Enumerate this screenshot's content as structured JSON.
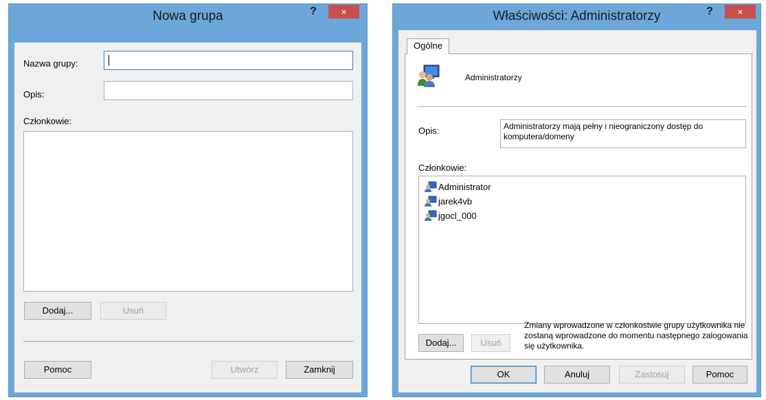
{
  "new_group": {
    "title": "Nowa grupa",
    "help_label": "?",
    "close_label": "×",
    "group_name_label": "Nazwa grupy:",
    "group_name_value": "",
    "description_label": "Opis:",
    "description_value": "",
    "members_label": "Członkowie:",
    "add_button": "Dodaj...",
    "remove_button": "Usuń",
    "help_button": "Pomoc",
    "create_button": "Utwórz",
    "close_button": "Zamknij"
  },
  "properties": {
    "title": "Właściwości: Administratorzy",
    "help_label": "?",
    "close_label": "×",
    "tab_general": "Ogólne",
    "group_name": "Administratorzy",
    "group_icon": "users-group-icon",
    "description_label": "Opis:",
    "description_value": "Administratorzy mają pełny i nieograniczony dostęp do komputera/domeny",
    "members_label": "Członkowie:",
    "members": [
      {
        "name": "Administrator",
        "icon": "user-computer-icon"
      },
      {
        "name": "jarek4vb",
        "icon": "user-computer-icon"
      },
      {
        "name": "jgocl_000",
        "icon": "user-computer-icon"
      }
    ],
    "add_button": "Dodaj...",
    "remove_button": "Usuń",
    "note": "Zmiany wprowadzone w członkostwie grupy użytkownika nie zostaną wprowadzone do momentu następnego zalogowania się użytkownika.",
    "ok_button": "OK",
    "cancel_button": "Anuluj",
    "apply_button": "Zastosuj",
    "help_button": "Pomoc"
  },
  "colors": {
    "frame": "#6ba7d9",
    "close": "#c7504b",
    "client": "#f0f0f0"
  }
}
